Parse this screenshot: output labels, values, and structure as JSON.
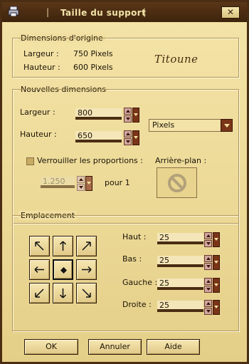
{
  "window": {
    "title": "Taille du support",
    "title_separator": "|",
    "close_glyph": "✕",
    "colors": {
      "frame": "#4a2d12",
      "title_text": "#f2e3a8",
      "client": "#f0e0a0"
    }
  },
  "original": {
    "legend": "Dimensions d'origine",
    "width_label": "Largeur :",
    "width_value": "750 Pixels",
    "height_label": "Hauteur :",
    "height_value": "600 Pixels",
    "signature": "Titoune"
  },
  "new_dims": {
    "legend": "Nouvelles dimensions",
    "width_label": "Largeur :",
    "width_value": "800",
    "height_label": "Hauteur :",
    "height_value": "650",
    "unit": "Pixels",
    "lock_label": "Verrouiller les proportions :",
    "lock_checked": false,
    "ratio_value": "1.250",
    "ratio_suffix": "pour 1",
    "background_label": "Arrière-plan :",
    "background_icon": "no-entry-icon"
  },
  "placement": {
    "legend": "Emplacement",
    "grid": [
      "arrow-up-left-icon",
      "arrow-up-icon",
      "arrow-up-right-icon",
      "arrow-left-icon",
      "center-dot-icon",
      "arrow-right-icon",
      "arrow-down-left-icon",
      "arrow-down-icon",
      "arrow-down-right-icon"
    ],
    "selected": "center",
    "top_label": "Haut :",
    "top_value": "25",
    "bottom_label": "Bas :",
    "bottom_value": "25",
    "left_label": "Gauche :",
    "left_value": "25",
    "right_label": "Droite :",
    "right_value": "25"
  },
  "buttons": {
    "ok": "OK",
    "cancel": "Annuler",
    "help": "Aide"
  }
}
